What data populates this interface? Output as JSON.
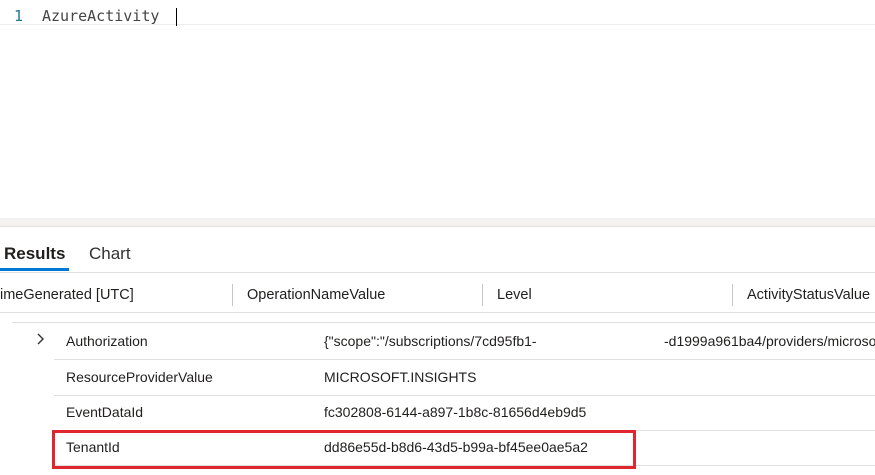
{
  "editor": {
    "line_number": "1",
    "query": "AzureActivity"
  },
  "tabs": [
    {
      "label": "Results",
      "active": true
    },
    {
      "label": "Chart",
      "active": false
    }
  ],
  "columns": [
    "imeGenerated [UTC]",
    "OperationNameValue",
    "Level",
    "ActivityStatusValue"
  ],
  "detail_rows": [
    {
      "key": "Authorization",
      "value": "{\"scope\":\"/subscriptions/7cd95fb1-",
      "value_overflow": "-d1999a961ba4/providers/microso",
      "expandable": true
    },
    {
      "key": "ResourceProviderValue",
      "value": "MICROSOFT.INSIGHTS"
    },
    {
      "key": "EventDataId",
      "value": "fc302808-6144-a897-1b8c-81656d4eb9d5"
    },
    {
      "key": "TenantId",
      "value": "dd86e55d-b8d6-43d5-b99a-bf45ee0ae5a2",
      "highlighted": true
    }
  ],
  "colors": {
    "accent": "#0078d4",
    "highlight_border": "#e0262e",
    "line_number": "#237893"
  },
  "icons": {
    "expander": "chevron-right-icon"
  }
}
